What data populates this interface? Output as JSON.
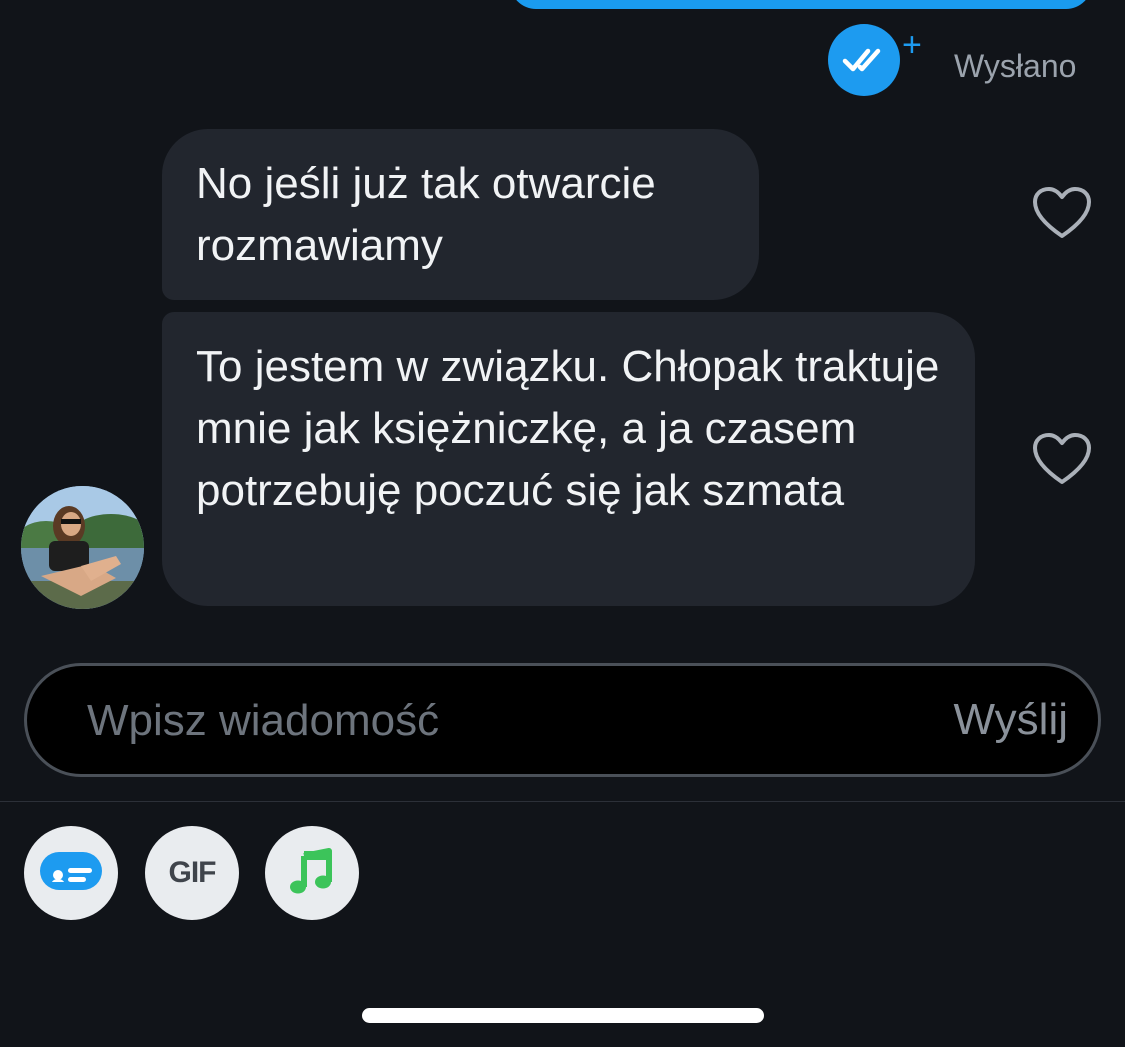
{
  "status": {
    "sent_label": "Wysłano",
    "plus_glyph": "+",
    "badge_icon": "double-check-icon",
    "accent_color": "#1d9bf0"
  },
  "messages": [
    {
      "text": "No jeśli już tak otwarcie rozmawiamy",
      "liked": false
    },
    {
      "text": "To jestem w związku. Chłopak traktuje mnie jak księżniczkę, a ja czasem potrzebuję poczuć się jak szmata",
      "liked": false
    }
  ],
  "composer": {
    "placeholder": "Wpisz wiadomość",
    "value": "",
    "send_label": "Wyślij"
  },
  "toolbar": {
    "card_icon": "card-icon",
    "gif_label": "GIF",
    "music_icon": "music-note-icon"
  }
}
